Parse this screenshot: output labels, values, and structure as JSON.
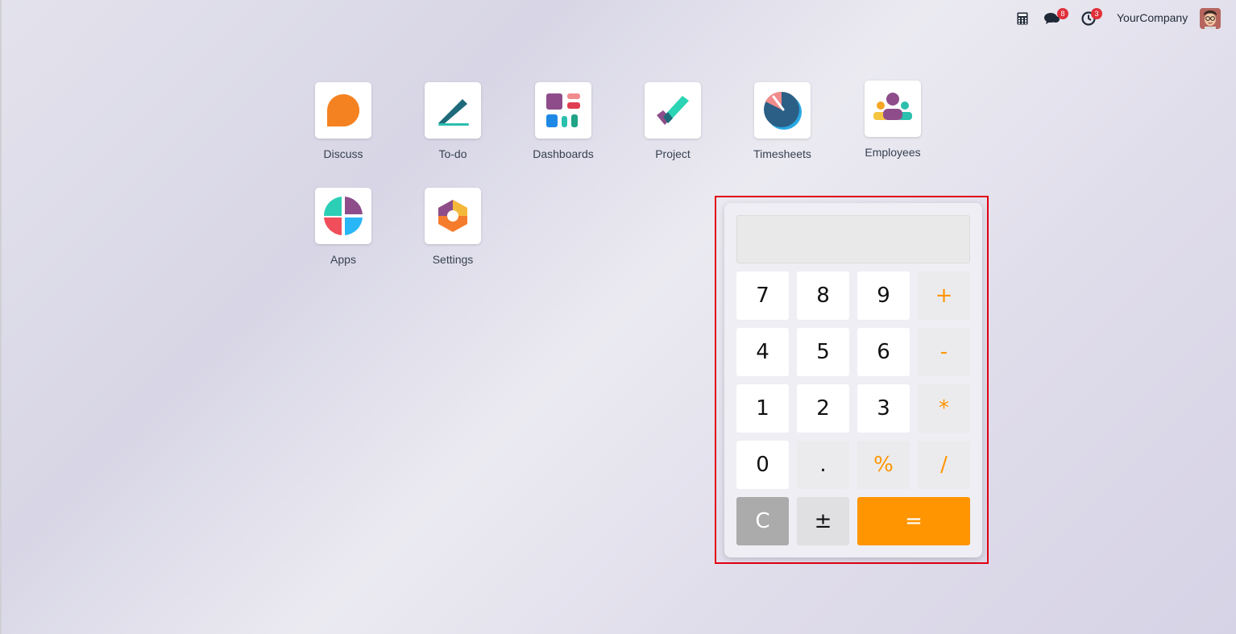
{
  "topbar": {
    "calculator_icon": "calculator-icon",
    "messages_icon": "chat-bubbles-icon",
    "messages_count": "8",
    "activities_icon": "clock-icon",
    "activities_count": "3",
    "company": "YourCompany",
    "avatar_icon": "user-avatar"
  },
  "apps": [
    {
      "label": "Discuss",
      "icon": "discuss-icon"
    },
    {
      "label": "To-do",
      "icon": "todo-icon"
    },
    {
      "label": "Dashboards",
      "icon": "dashboards-icon"
    },
    {
      "label": "Project",
      "icon": "project-icon"
    },
    {
      "label": "Timesheets",
      "icon": "timesheets-icon"
    },
    {
      "label": "Employees",
      "icon": "employees-icon"
    },
    {
      "label": "Apps",
      "icon": "apps-icon"
    },
    {
      "label": "Settings",
      "icon": "settings-icon"
    }
  ],
  "calculator": {
    "display": "",
    "keys": {
      "k7": "7",
      "k8": "8",
      "k9": "9",
      "plus": "+",
      "k4": "4",
      "k5": "5",
      "k6": "6",
      "minus": "-",
      "k1": "1",
      "k2": "2",
      "k3": "3",
      "multiply": "*",
      "k0": "0",
      "dot": ".",
      "percent": "%",
      "divide": "/",
      "clear": "C",
      "sign": "±",
      "equals": "="
    }
  },
  "colors": {
    "accent_orange": "#ff9500",
    "badge_red": "#e0303a",
    "highlight_red": "#e00012"
  }
}
